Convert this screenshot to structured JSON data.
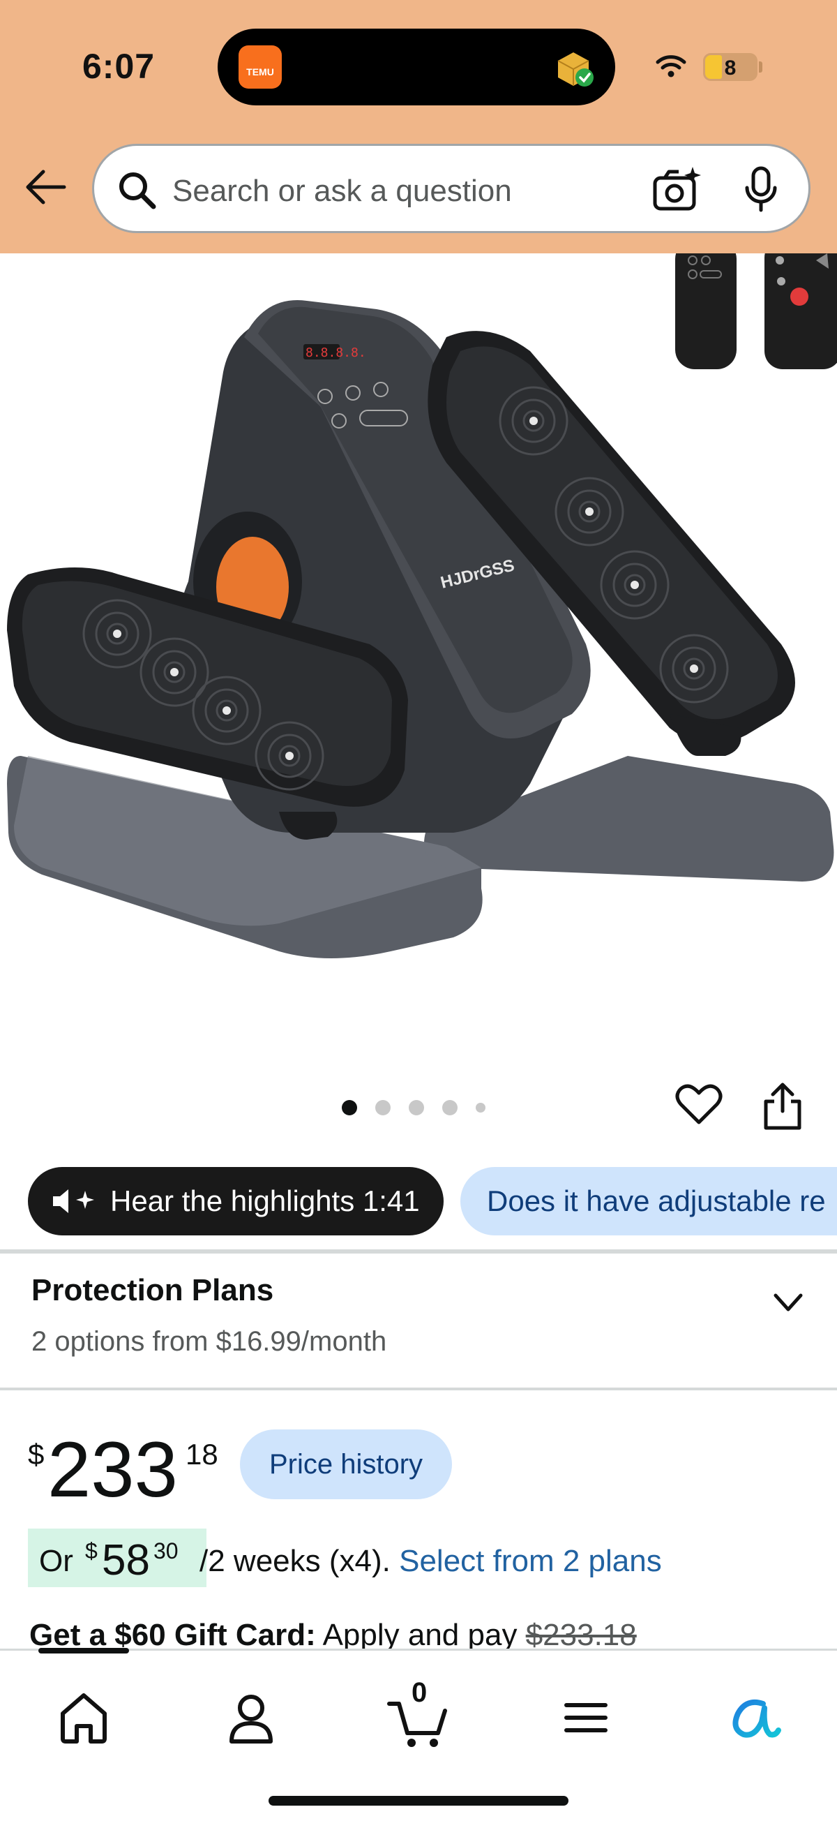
{
  "status_bar": {
    "time": "6:07",
    "battery": "8",
    "island_app": "TEMU"
  },
  "search": {
    "placeholder": "Search or ask a question"
  },
  "product": {
    "brand_mark": "HJDrGSS",
    "carousel": {
      "total": 5,
      "active": 0
    }
  },
  "chips": {
    "audio": "Hear the highlights 1:41",
    "question": "Does it have adjustable re"
  },
  "protection": {
    "title": "Protection Plans",
    "subtitle": "2 options from $16.99/month"
  },
  "price": {
    "symbol": "$",
    "whole": "233",
    "fraction": "18",
    "history_label": "Price history"
  },
  "installment": {
    "or": "Or",
    "dollar": "$",
    "whole": "58",
    "fraction": "30",
    "terms": "/2 weeks (x4).",
    "link": "Select from 2 plans"
  },
  "gift": {
    "bold": "Get a $60 Gift Card:",
    "text": "Apply and pay",
    "strike_price": "$233.18"
  },
  "bottom_nav": {
    "items": [
      "home-icon",
      "account-icon",
      "cart-icon",
      "menu-icon",
      "rufus-icon"
    ],
    "cart_count": "0"
  },
  "colors": {
    "header_bg": "#f0b689",
    "chip_light_bg": "#cfe4fc",
    "link": "#2162a1",
    "installment_bg": "#d6f4e6",
    "accent_orange": "#e9772e"
  }
}
